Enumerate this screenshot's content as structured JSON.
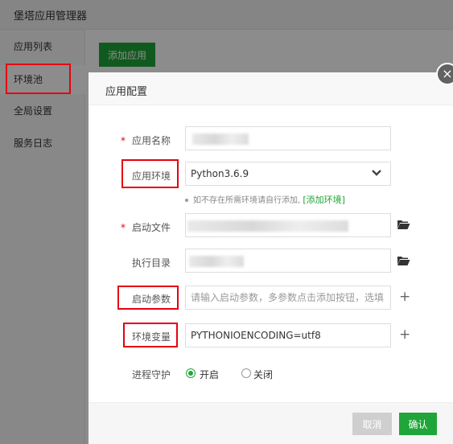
{
  "app": {
    "title": "堡塔应用管理器",
    "sidebar": [
      {
        "label": "应用列表"
      },
      {
        "label": "环境池"
      },
      {
        "label": "全局设置"
      },
      {
        "label": "服务日志"
      }
    ],
    "add_app_label": "添加应用"
  },
  "modal": {
    "title": "应用配置",
    "close_label": "×",
    "fields": {
      "app_name": {
        "label": "应用名称",
        "required_mark": "*",
        "value": ""
      },
      "app_env": {
        "label": "应用环境",
        "value": "Python3.6.9"
      },
      "env_hint": {
        "text": "如不存在所需环境请自行添加,",
        "link": "[添加环境]"
      },
      "start_file": {
        "label": "启动文件",
        "required_mark": "*",
        "value": ""
      },
      "exec_dir": {
        "label": "执行目录",
        "value": ""
      },
      "start_params": {
        "label": "启动参数",
        "placeholder": "请输入启动参数，多参数点击添加按钮，选填"
      },
      "env_vars": {
        "label": "环境变量",
        "value": "PYTHONIOENCODING=utf8"
      },
      "daemon": {
        "label": "进程守护",
        "options": [
          {
            "label": "开启",
            "checked": true
          },
          {
            "label": "关闭",
            "checked": false
          }
        ]
      }
    },
    "buttons": {
      "cancel": "取消",
      "confirm": "确认"
    }
  },
  "colors": {
    "accent": "#20a53a",
    "highlight": "#e60012"
  }
}
